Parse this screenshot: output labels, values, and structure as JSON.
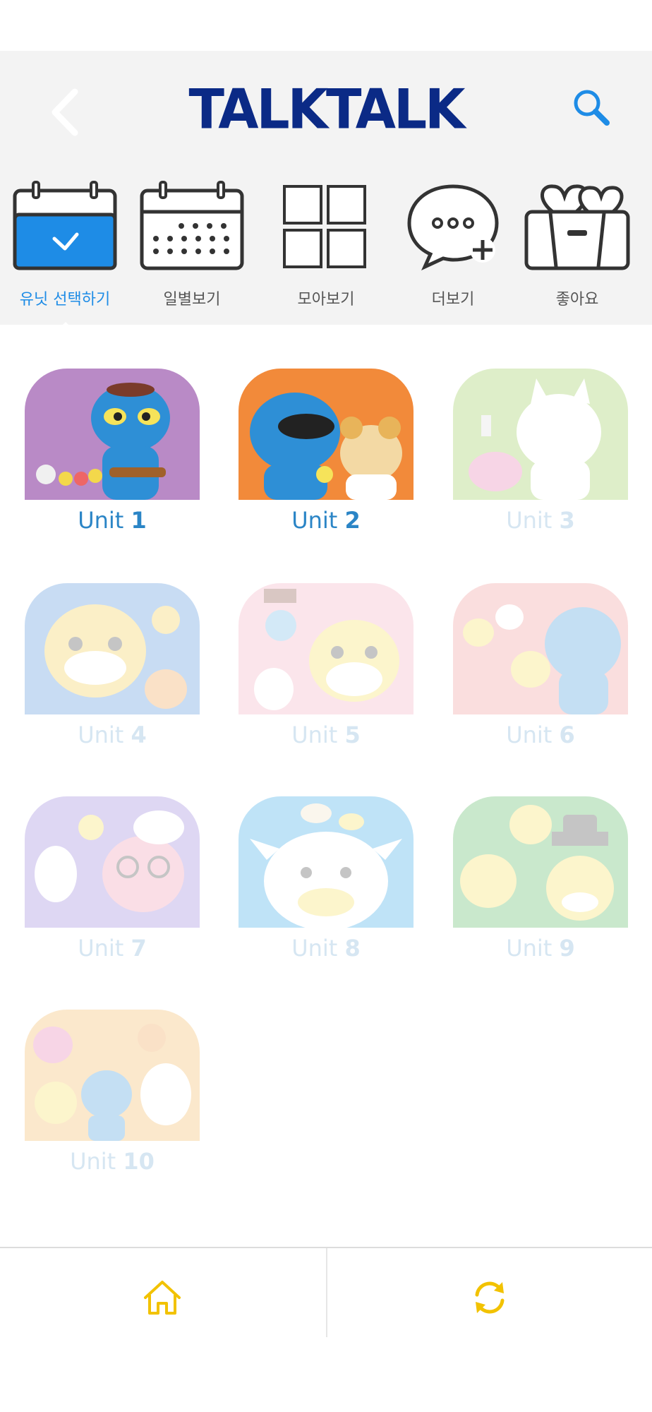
{
  "header": {
    "title": "TALKTALK"
  },
  "tabs": [
    {
      "label": "유닛 선택하기"
    },
    {
      "label": "일별보기"
    },
    {
      "label": "모아보기"
    },
    {
      "label": "더보기"
    },
    {
      "label": "좋아요"
    }
  ],
  "units": [
    {
      "prefix": "Unit ",
      "number": "1"
    },
    {
      "prefix": "Unit ",
      "number": "2"
    },
    {
      "prefix": "Unit ",
      "number": "3"
    },
    {
      "prefix": "Unit ",
      "number": "4"
    },
    {
      "prefix": "Unit ",
      "number": "5"
    },
    {
      "prefix": "Unit ",
      "number": "6"
    },
    {
      "prefix": "Unit ",
      "number": "7"
    },
    {
      "prefix": "Unit ",
      "number": "8"
    },
    {
      "prefix": "Unit ",
      "number": "9"
    },
    {
      "prefix": "Unit ",
      "number": "10"
    }
  ],
  "colors": {
    "header_bg": "#f3f3f3",
    "logo": "#0b2a86",
    "active_tab": "#1e8ce6",
    "unit_label": "#2b85c6",
    "bottom_icon": "#f2c200"
  },
  "icons": {
    "back": "back-arrow-icon",
    "search": "search-icon",
    "home": "home-icon",
    "refresh": "refresh-icon"
  }
}
